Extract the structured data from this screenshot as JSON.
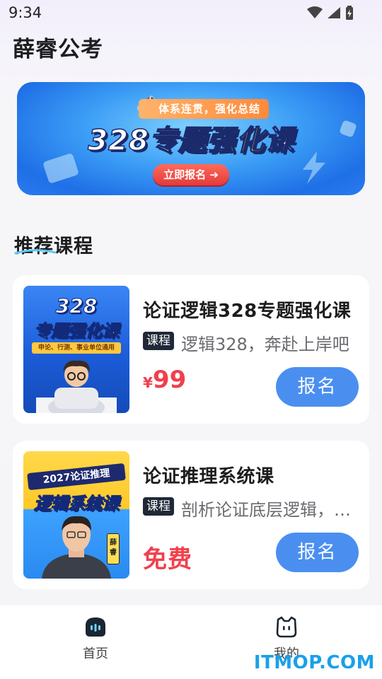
{
  "status_bar": {
    "time": "9:34"
  },
  "app": {
    "title": "薛睿公考"
  },
  "banner": {
    "tag": "体系连贯，强化总结",
    "title_prefix": "328专题",
    "title_highlight": "强化",
    "title_suffix": "课",
    "button": "立即报名 ➔"
  },
  "section": {
    "title": "推荐课程"
  },
  "courses": [
    {
      "title": "论证逻辑328专题强化课",
      "tag": "课程",
      "subtitle": "逻辑328，奔赴上岸吧",
      "price_symbol": "¥",
      "price": "99",
      "button": "报名",
      "thumb": {
        "line1": "328",
        "line2": "专题强化课",
        "line3": "申论、行测、事业单位通用"
      }
    },
    {
      "title": "论证推理系统课",
      "tag": "课程",
      "subtitle": "剖析论证底层逻辑，构建推理体系",
      "price_text": "免费",
      "button": "报名",
      "thumb": {
        "line1": "2027论证推理",
        "line2": "逻辑系统课",
        "badge": "薛睿"
      }
    }
  ],
  "bottom_nav": {
    "items": [
      {
        "label": "首页",
        "icon": "home-bot-icon",
        "active": true
      },
      {
        "label": "我的",
        "icon": "profile-cat-icon",
        "active": false
      }
    ]
  },
  "watermark": "ITMOP.COM",
  "colors": {
    "accent": "#4a8ff0",
    "price": "#f0404c"
  }
}
